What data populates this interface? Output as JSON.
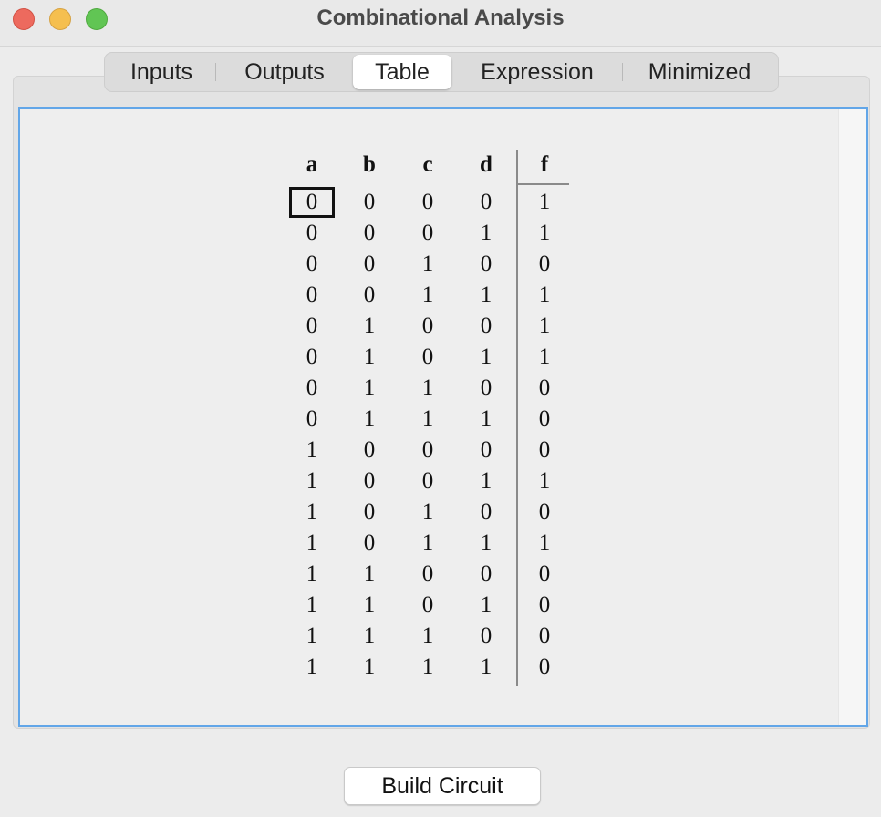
{
  "window": {
    "title": "Combinational Analysis"
  },
  "tabs": [
    {
      "label": "Inputs",
      "selected": false
    },
    {
      "label": "Outputs",
      "selected": false
    },
    {
      "label": "Table",
      "selected": true
    },
    {
      "label": "Expression",
      "selected": false
    },
    {
      "label": "Minimized",
      "selected": false
    }
  ],
  "truth_table": {
    "inputs": [
      "a",
      "b",
      "c",
      "d"
    ],
    "outputs": [
      "f"
    ],
    "rows": [
      [
        "0",
        "0",
        "0",
        "0",
        "1"
      ],
      [
        "0",
        "0",
        "0",
        "1",
        "1"
      ],
      [
        "0",
        "0",
        "1",
        "0",
        "0"
      ],
      [
        "0",
        "0",
        "1",
        "1",
        "1"
      ],
      [
        "0",
        "1",
        "0",
        "0",
        "1"
      ],
      [
        "0",
        "1",
        "0",
        "1",
        "1"
      ],
      [
        "0",
        "1",
        "1",
        "0",
        "0"
      ],
      [
        "0",
        "1",
        "1",
        "1",
        "0"
      ],
      [
        "1",
        "0",
        "0",
        "0",
        "0"
      ],
      [
        "1",
        "0",
        "0",
        "1",
        "1"
      ],
      [
        "1",
        "0",
        "1",
        "0",
        "0"
      ],
      [
        "1",
        "0",
        "1",
        "1",
        "1"
      ],
      [
        "1",
        "1",
        "0",
        "0",
        "0"
      ],
      [
        "1",
        "1",
        "0",
        "1",
        "0"
      ],
      [
        "1",
        "1",
        "1",
        "0",
        "0"
      ],
      [
        "1",
        "1",
        "1",
        "1",
        "0"
      ]
    ],
    "selected_cell": {
      "row": 0,
      "col": 0
    }
  },
  "buttons": {
    "build_circuit": "Build Circuit"
  },
  "colors": {
    "accent": "#62a6e8",
    "close": "#ed6a5e",
    "minimize": "#f5bf4f",
    "maximize": "#61c554"
  }
}
